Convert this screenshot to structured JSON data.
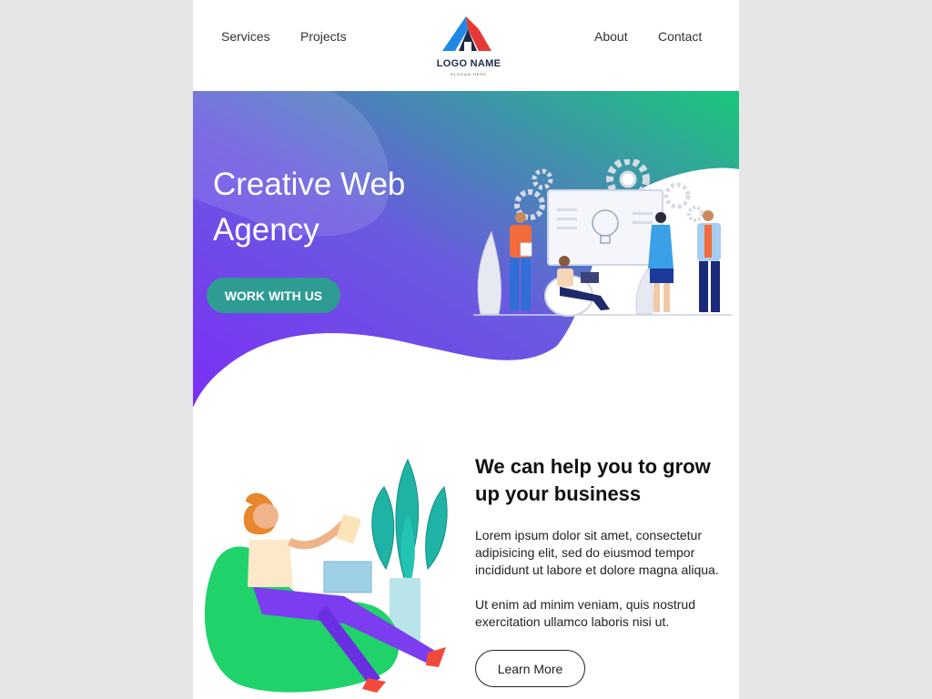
{
  "header": {
    "nav_left": [
      "Services",
      "Projects"
    ],
    "nav_right": [
      "About",
      "Contact"
    ],
    "logo": {
      "name": "LOGO NAME",
      "slogan": "SLOGAN HERE"
    }
  },
  "hero": {
    "title": "Creative Web Agency",
    "button_label": "WORK WITH US",
    "gradient_colors": [
      "#7b2ff7",
      "#6a5ae0",
      "#19c77a"
    ],
    "button_color": "#2e9c93"
  },
  "content": {
    "title": "We can help you to grow up your business",
    "paragraph_1": "Lorem ipsum dolor sit amet, consectetur adipisicing elit, sed do eiusmod tempor incididunt ut labore et dolore magna aliqua.",
    "paragraph_2": "Ut enim ad minim veniam, quis nostrud exercitation ullamco laboris nisi ut.",
    "button_label": "Learn More"
  }
}
